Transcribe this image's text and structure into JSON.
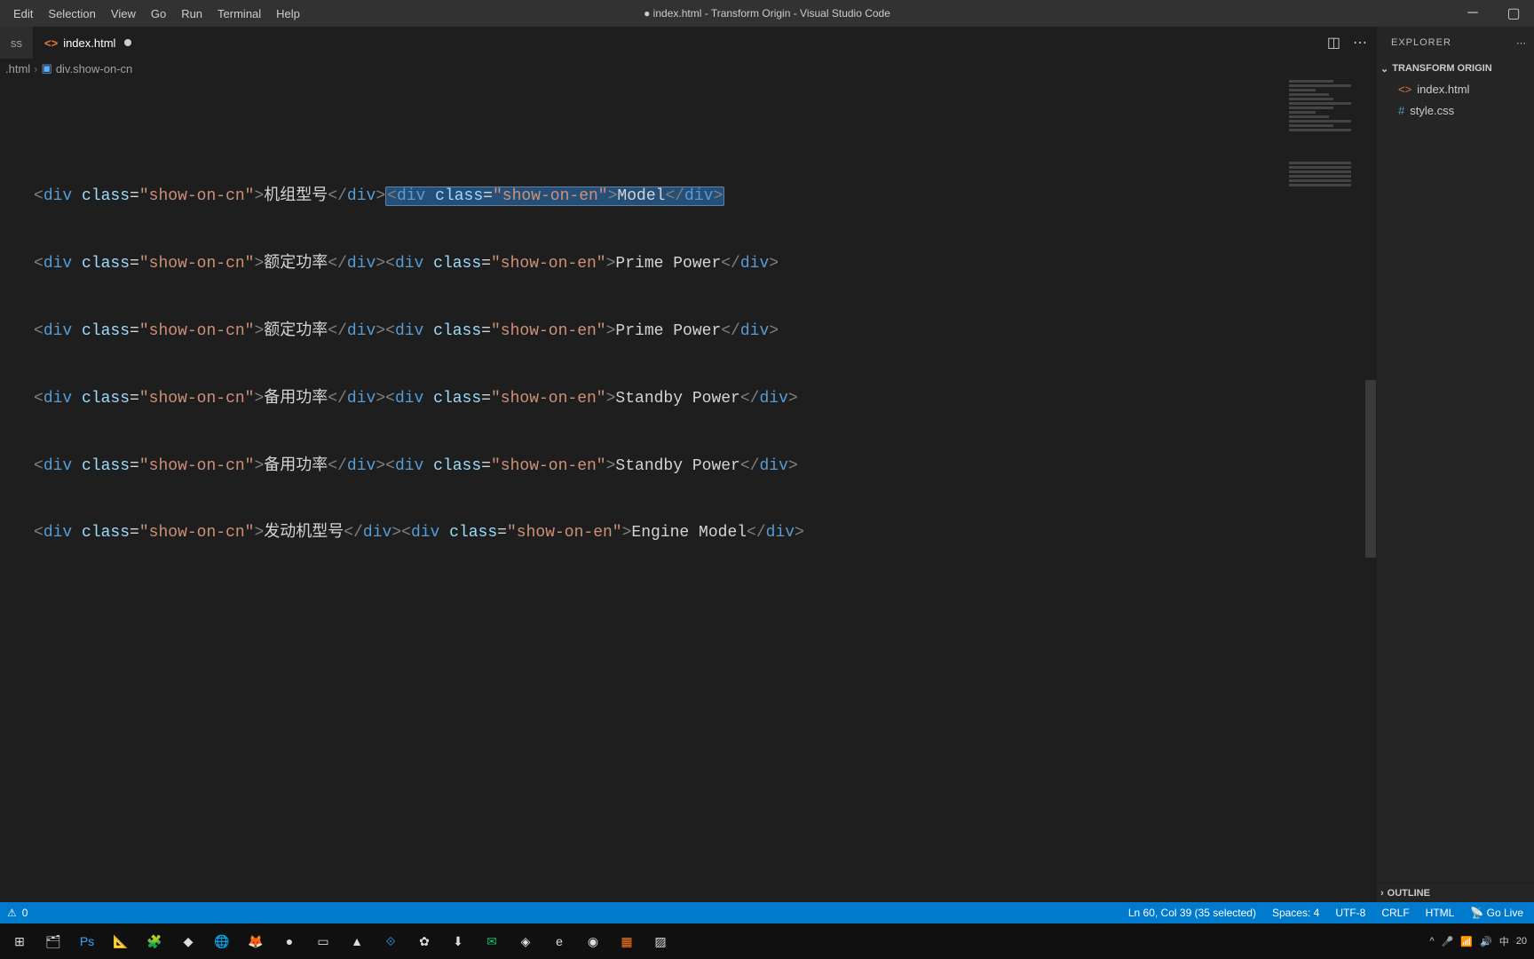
{
  "menu": [
    "Edit",
    "Selection",
    "View",
    "Go",
    "Run",
    "Terminal",
    "Help"
  ],
  "window_title": "● index.html - Transform Origin - Visual Studio Code",
  "tabs": [
    {
      "label": "ss",
      "active": false
    },
    {
      "label": "index.html",
      "active": true,
      "modified": true
    }
  ],
  "breadcrumbs": {
    "file": ".html",
    "symbol": "div.show-on-cn"
  },
  "explorer": {
    "title": "EXPLORER",
    "project": "TRANSFORM ORIGIN",
    "files": [
      {
        "name": "index.html",
        "type": "html"
      },
      {
        "name": "style.css",
        "type": "css"
      }
    ],
    "outline": "OUTLINE"
  },
  "status": {
    "problems": "0",
    "cursor": "Ln 60, Col 39 (35 selected)",
    "spaces": "Spaces: 4",
    "encoding": "UTF-8",
    "eol": "CRLF",
    "lang": "HTML",
    "golive": "Go Live"
  },
  "code": {
    "lines": [
      {
        "cn": "机组型号",
        "en": "Model",
        "selected_en": true
      },
      {
        "cn": "额定功率",
        "en": "Prime Power"
      },
      {
        "cn": "额定功率",
        "en": "Prime Power"
      },
      {
        "cn": "备用功率",
        "en": "Standby Power"
      },
      {
        "cn": "备用功率",
        "en": "Standby Power"
      },
      {
        "cn": "发动机型号",
        "en": "Engine Model"
      }
    ],
    "class_cn": "show-on-cn",
    "class_en": "show-on-en"
  },
  "tray": {
    "ime": "中",
    "time": "20"
  }
}
